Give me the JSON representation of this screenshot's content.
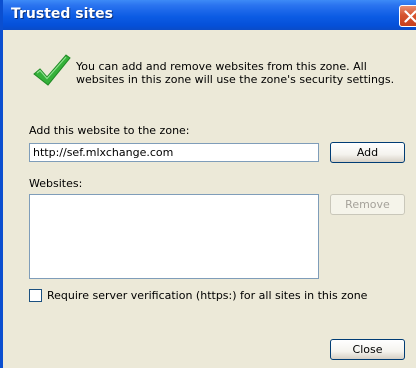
{
  "window": {
    "title": "Trusted sites"
  },
  "info": {
    "icon": "green-checkmark-icon",
    "text": "You can add and remove websites from this zone. All websites in this zone will use the zone's security settings."
  },
  "add_section": {
    "label": "Add this website to the zone:",
    "url_value": "http://sef.mlxchange.com",
    "add_label": "Add"
  },
  "websites": {
    "label": "Websites:",
    "items": [],
    "remove_label": "Remove"
  },
  "verification": {
    "label": "Require server verification (https:) for all sites in this zone",
    "checked": false
  },
  "footer": {
    "close_label": "Close"
  }
}
